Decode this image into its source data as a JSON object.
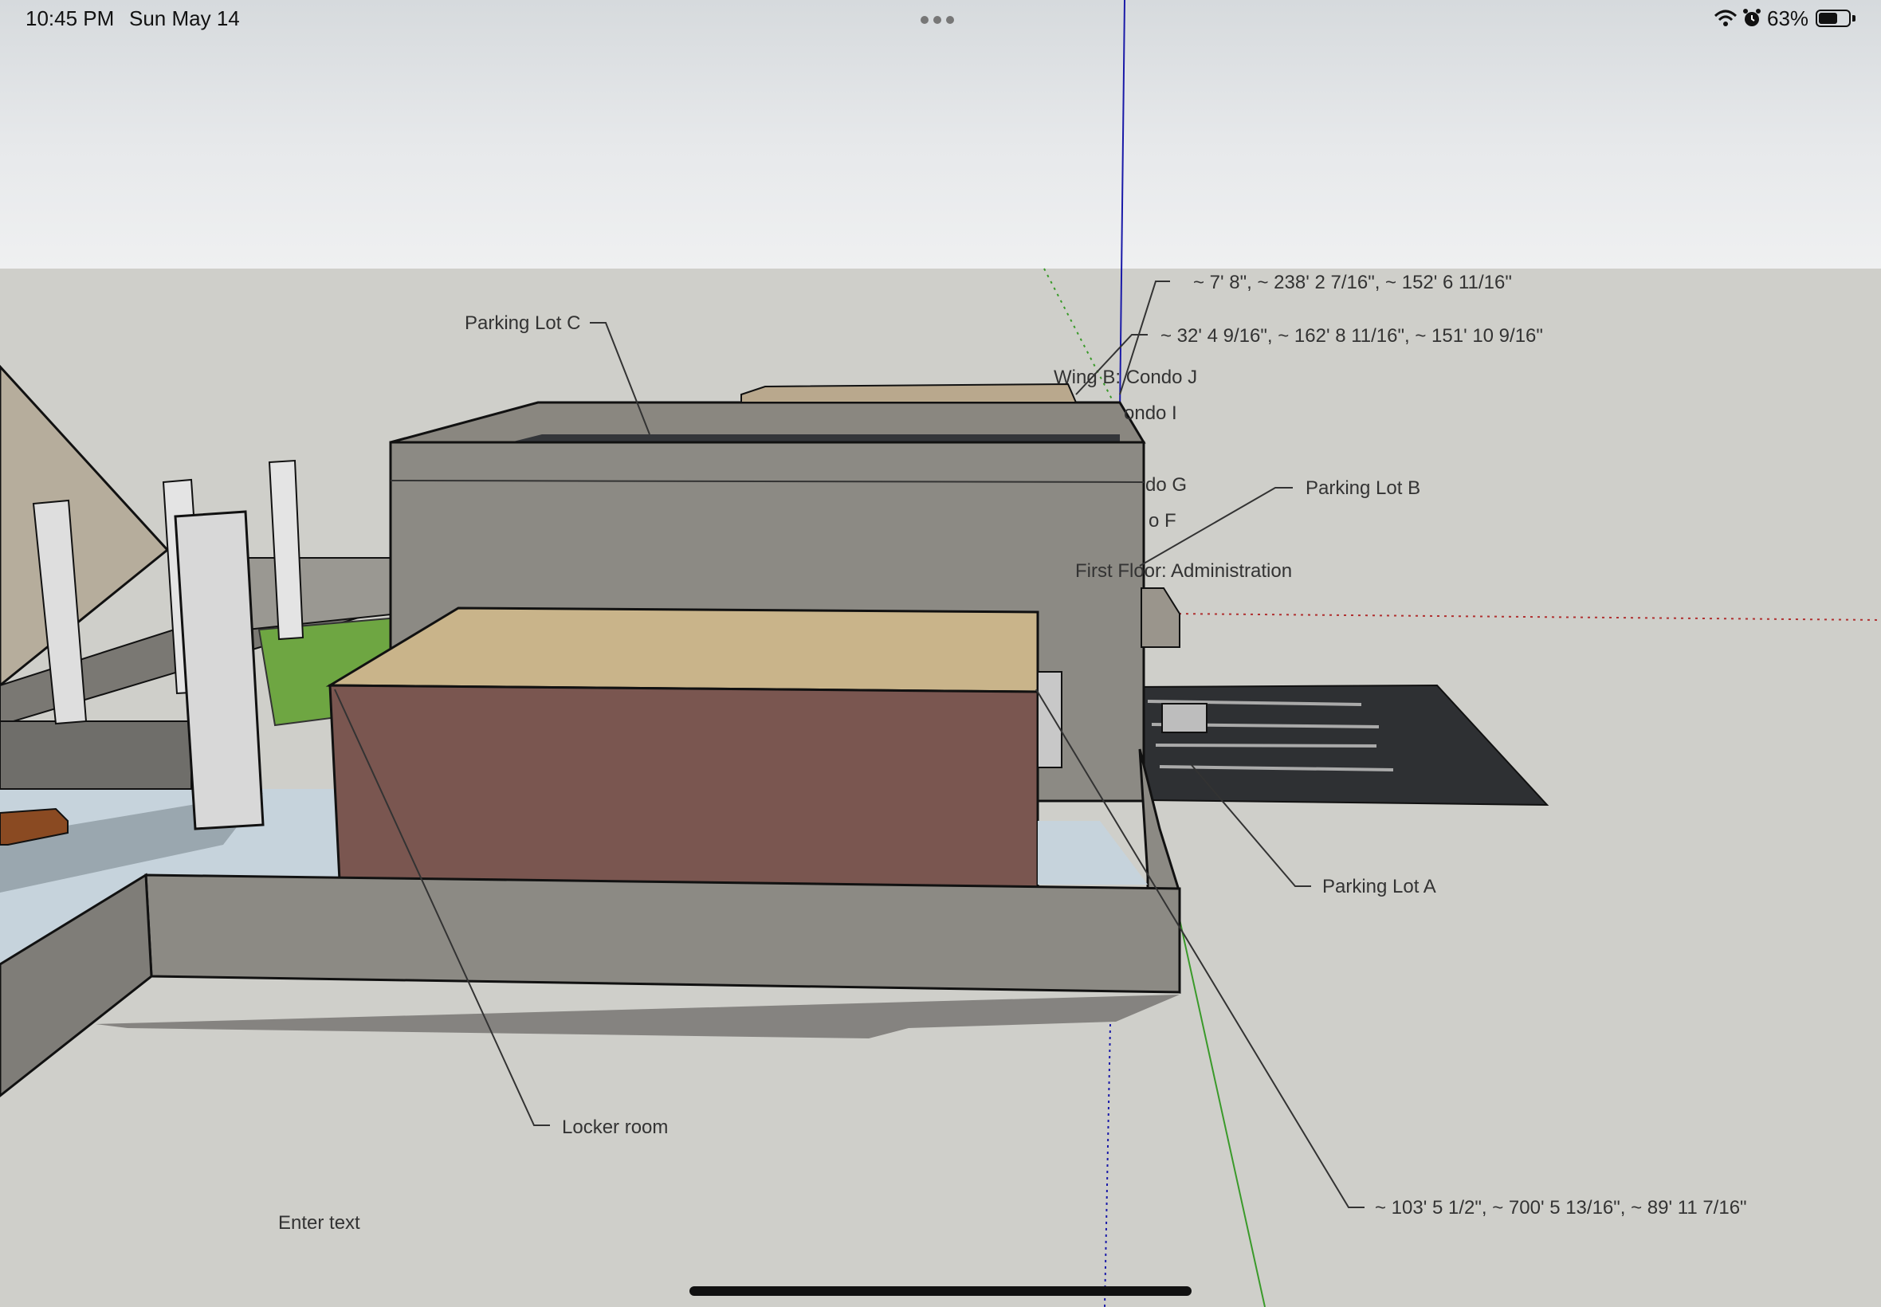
{
  "status_bar": {
    "time": "10:45 PM",
    "date": "Sun May 14",
    "battery_percent": "63%",
    "battery_level": 0.63,
    "icons": [
      "wifi-icon",
      "alarm-icon",
      "battery-icon"
    ]
  },
  "model_tags": {
    "parking_lot_c": "Parking Lot C",
    "parking_lot_b": "Parking Lot B",
    "parking_lot_a": "Parking Lot A",
    "locker_room": "Locker room",
    "wing_b_condo_j": "Wing B: Condo J",
    "condo_i": "ondo I",
    "condo_g": "do G",
    "condo_f": "o F",
    "first_floor": "First Floor: Administration",
    "coord_1": "~ 7' 8\", ~ 238' 2 7/16\", ~ 152' 6 11/16\"",
    "coord_2": "~ 32' 4 9/16\", ~ 162' 8 11/16\", ~ 151' 10 9/16\"",
    "coord_3": "~ 103' 5 1/2\", ~ 700' 5 13/16\", ~ 89' 11 7/16\"",
    "enter_text": "Enter text"
  },
  "colors": {
    "sky": "#e7e9eb",
    "ground": "#cfcfca",
    "brick": "#7a5650",
    "roof_tan": "#c9b48a",
    "concrete": "#8f8c85",
    "parking": "#2e3033",
    "axis_blue": "#1a1aa8",
    "axis_green": "#3a9a2a",
    "axis_red": "#b03030"
  }
}
